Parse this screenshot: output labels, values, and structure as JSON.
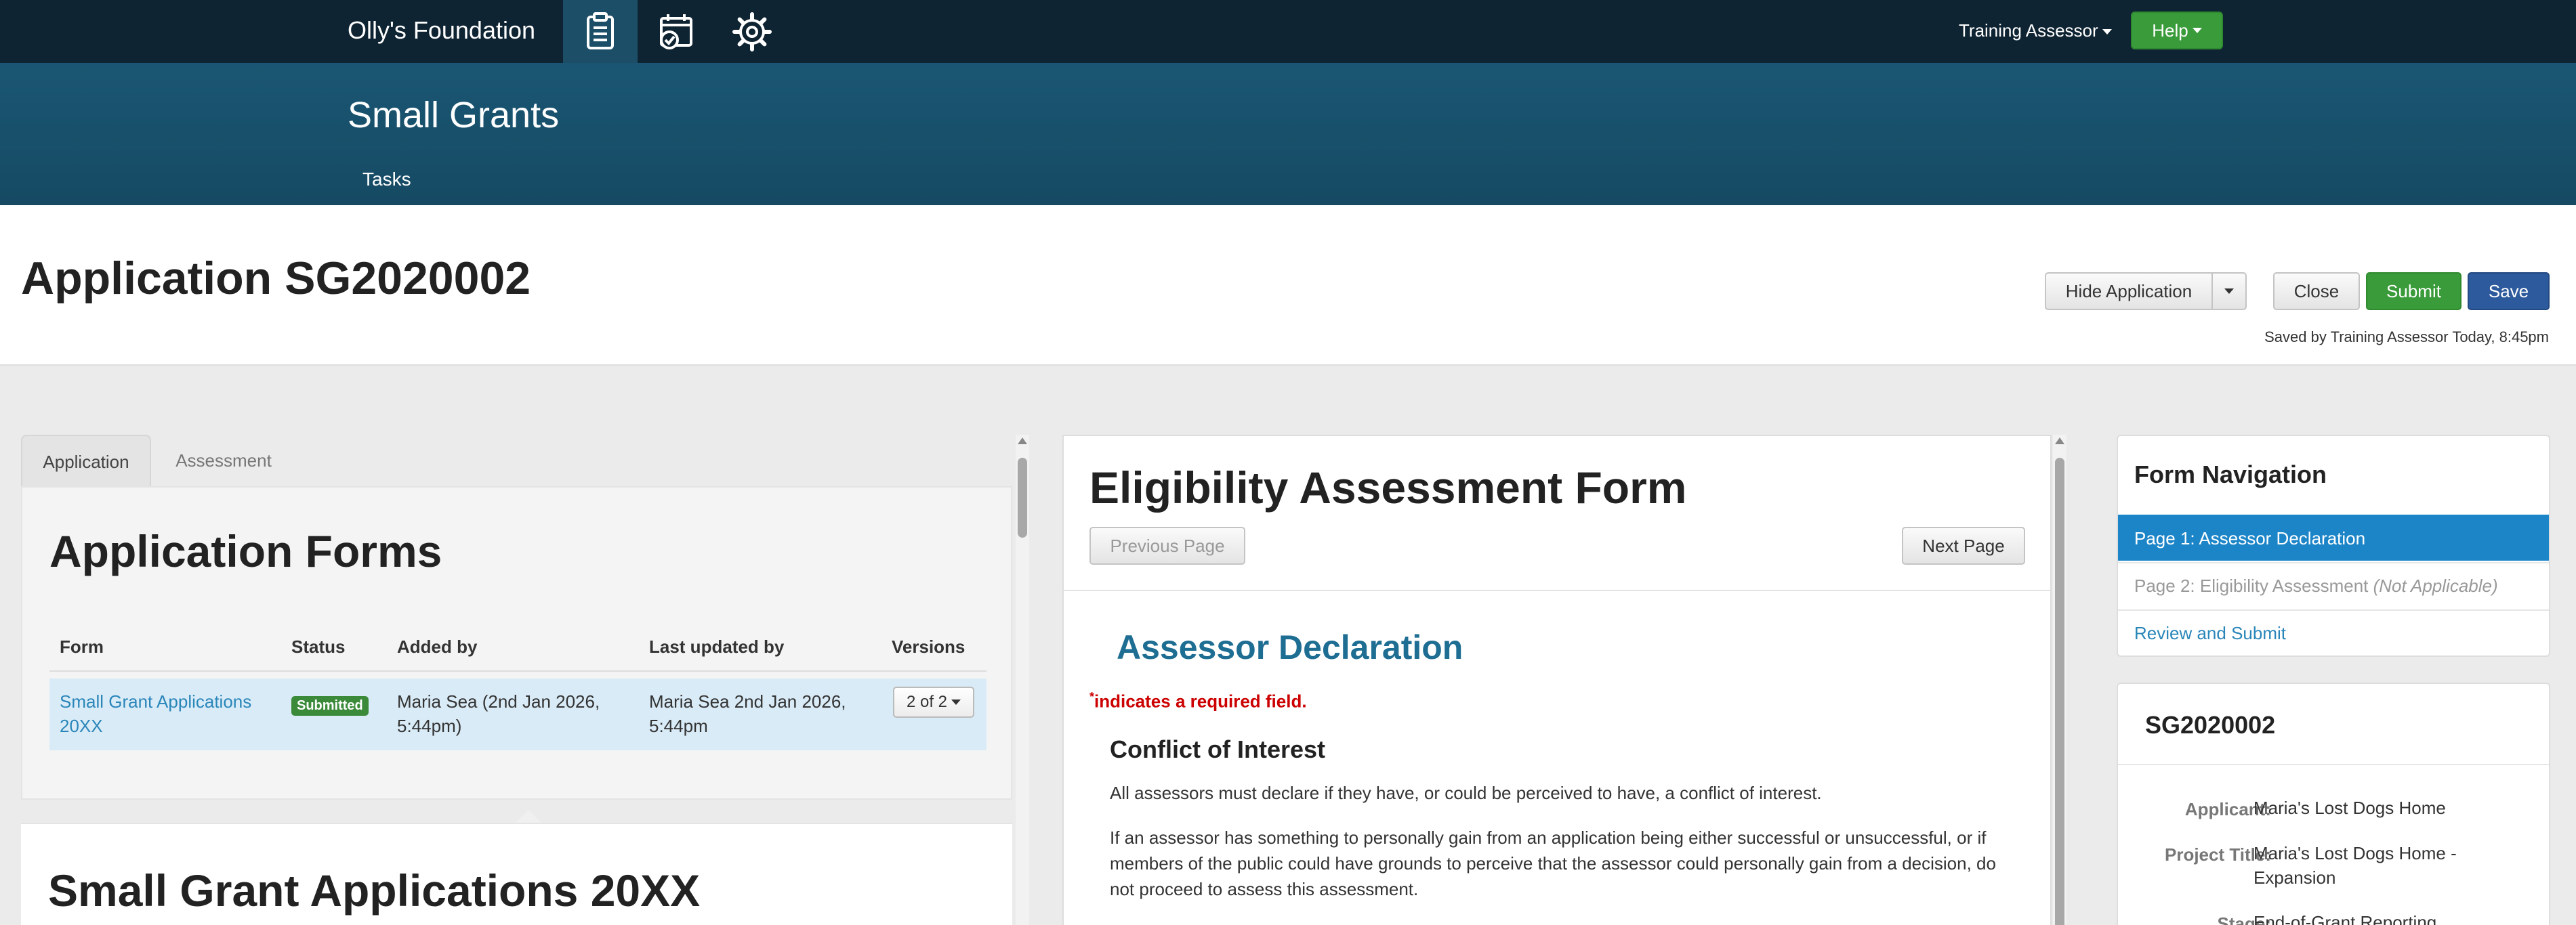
{
  "topnav": {
    "brand": "Olly's Foundation",
    "user_menu": "Training Assessor",
    "help_label": "Help",
    "icons": [
      "clipboard-icon",
      "calendar-check-icon",
      "gear-icon"
    ]
  },
  "subheader": {
    "title": "Small Grants",
    "tasks_label": "Tasks"
  },
  "page": {
    "title": "Application SG2020002",
    "hide_application_label": "Hide Application",
    "close_label": "Close",
    "submit_label": "Submit",
    "save_label": "Save",
    "saved_text": "Saved by Training Assessor Today, 8:45pm"
  },
  "left": {
    "tabs": [
      "Application",
      "Assessment"
    ],
    "forms_title": "Application Forms",
    "table": {
      "headers": [
        "Form",
        "Status",
        "Added by",
        "Last updated by",
        "Versions"
      ],
      "row": {
        "form": "Small Grant Applications 20XX",
        "status": "Submitted",
        "added_by": "Maria Sea (2nd Jan 2026, 5:44pm)",
        "last_updated_by": "Maria Sea 2nd Jan 2026, 5:44pm",
        "versions": "2 of 2"
      }
    },
    "form_title": "Small Grant Applications 20XX"
  },
  "middle": {
    "title": "Eligibility Assessment Form",
    "prev_label": "Previous Page",
    "next_label": "Next Page",
    "section_title": "Assessor Declaration",
    "required_mark": "*",
    "required_text": "indicates a required field.",
    "coi_title": "Conflict of Interest",
    "para1": "All assessors must declare if they have, or could be perceived to have, a conflict of interest.",
    "para2": "If an assessor has something to personally gain from an application being either successful or unsuccessful, or if members of the public could have grounds to perceive that the assessor could personally gain from a decision, do not proceed to assess this assessment."
  },
  "right": {
    "nav_title": "Form Navigation",
    "nav_items": {
      "page1": "Page 1: Assessor Declaration",
      "page2": "Page 2: Eligibility Assessment",
      "page2_note": "(Not Applicable)",
      "review": "Review and Submit"
    },
    "summary": {
      "id": "SG2020002",
      "applicant_label": "Applicant:",
      "applicant": "Maria's Lost Dogs Home",
      "project_label": "Project Title:",
      "project": "Maria's Lost Dogs Home - Expansion",
      "stage_label": "Stage:",
      "stage": "End-of-Grant Reporting"
    }
  },
  "colors": {
    "topnav": "#0f2433",
    "subheader": "#1a5673",
    "accent_blue": "#1c85c8",
    "green": "#3a9b3a",
    "save_blue": "#2d5a9c",
    "section_title": "#1e6d93"
  }
}
